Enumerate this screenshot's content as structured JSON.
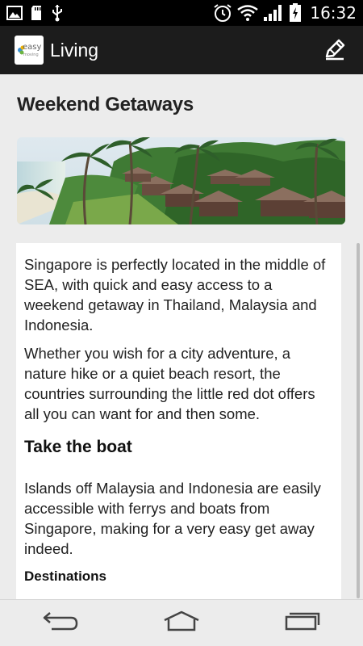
{
  "status_bar": {
    "time": "16:32",
    "left_icons": [
      "image-icon",
      "sd-card-icon",
      "usb-icon"
    ],
    "right_icons": [
      "alarm-icon",
      "wifi-icon",
      "signal-icon",
      "battery-charging-icon"
    ]
  },
  "action_bar": {
    "logo_text": "easy",
    "logo_subtext": "moving",
    "title": "Living",
    "edit_icon": "pencil-icon"
  },
  "page": {
    "title": "Weekend Getaways",
    "banner_alt": "beach resort with huts and palm trees",
    "paragraphs": [
      "Singapore is perfectly located in the middle of SEA, with quick and easy access to a weekend getaway in Thailand, Malaysia and Indonesia.",
      "Whether you wish for a city adventure, a nature hike or a quiet beach resort, the countries surrounding the little red dot offers all you can want for and then some."
    ],
    "section_heading": "Take the boat",
    "section_paragraph": "Islands off Malaysia and Indonesia are easily accessible with ferrys and boats from Singapore, making for a very easy get away indeed.",
    "subheading": "Destinations"
  },
  "nav_bar": {
    "back": "back-icon",
    "home": "home-icon",
    "recents": "recent-apps-icon"
  },
  "colors": {
    "status_bar": "#000000",
    "action_bar": "#1c1c1c",
    "content_bg": "#ececec",
    "card_bg": "#ffffff"
  }
}
